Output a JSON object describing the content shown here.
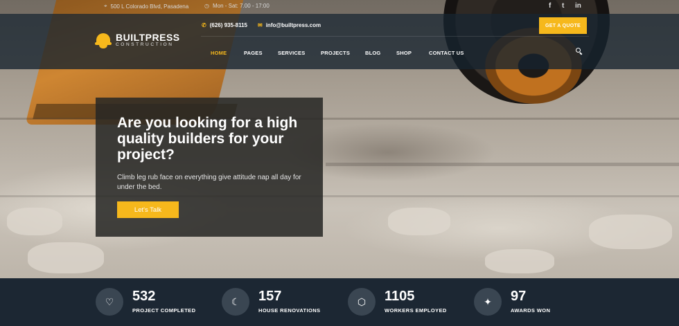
{
  "topbar": {
    "address": "500 L Colorado Blvd, Pasadena",
    "hours": "Mon - Sat: 7.00 - 17:00",
    "social": [
      {
        "icon": "facebook-icon",
        "glyph": "f"
      },
      {
        "icon": "twitter-icon",
        "glyph": "t"
      },
      {
        "icon": "linkedin-icon",
        "glyph": "in"
      }
    ]
  },
  "header": {
    "logo_main": "BUILTPRESS",
    "logo_sub": "CONSTRUCTION",
    "phone": "(626) 935-8115",
    "email": "info@builtpress.com",
    "quote_button": "GET A QUOTE",
    "nav": [
      "HOME",
      "PAGES",
      "SERVICES",
      "PROJECTS",
      "BLOG",
      "SHOP",
      "CONTACT US"
    ],
    "active_nav": "HOME"
  },
  "hero": {
    "title": "Are you looking for a high quality builders for your project?",
    "text": "Climb leg rub face on everything give attitude nap all day for under the bed.",
    "cta": "Let's Talk"
  },
  "stats": [
    {
      "number": "532",
      "label": "PROJECT COMPLETED",
      "icon": "heart-icon",
      "glyph": "♡"
    },
    {
      "number": "157",
      "label": "HOUSE RENOVATIONS",
      "icon": "moon-icon",
      "glyph": "☾"
    },
    {
      "number": "1105",
      "label": "WORKERS EMPLOYED",
      "icon": "cube-icon",
      "glyph": "⬡"
    },
    {
      "number": "97",
      "label": "AWARDS WON",
      "icon": "award-icon",
      "glyph": "✦"
    }
  ],
  "colors": {
    "accent": "#f6b81c",
    "header_bg": "#16222e",
    "stats_bg": "#1c2733",
    "stat_icon_bg": "#3a4652"
  }
}
